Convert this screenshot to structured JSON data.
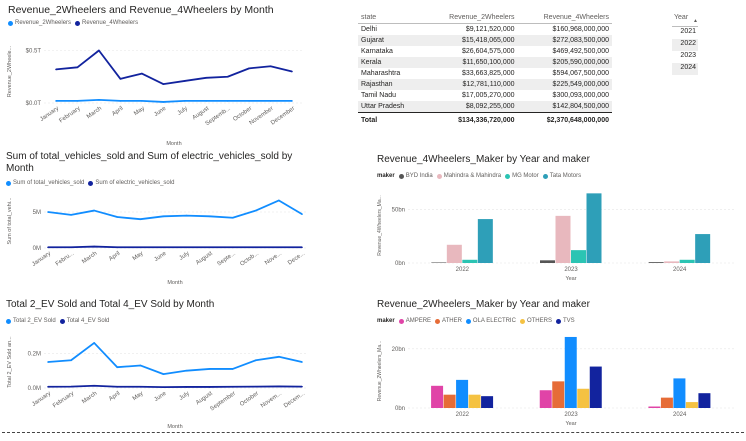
{
  "colors": {
    "light_blue": "#118DFF",
    "dark_blue": "#12239E",
    "byd": "#555555",
    "mahindra": "#E8B8BE",
    "mg": "#2BC4B3",
    "tata": "#2E9FB8",
    "ampere": "#E044A7",
    "ather": "#E66C37",
    "ola": "#118DFF",
    "others": "#F5C242",
    "tvs": "#12239E"
  },
  "months": [
    "January",
    "February",
    "March",
    "April",
    "May",
    "June",
    "July",
    "August",
    "September",
    "October",
    "November",
    "December"
  ],
  "chart1": {
    "title": "Revenue_2Wheelers and Revenue_4Wheelers by Month",
    "legend": [
      "Revenue_2Wheelers",
      "Revenue_4Wheelers"
    ],
    "xlabel": "Month",
    "ylabel": "Revenue_2Wheele...",
    "month_labels": [
      "January",
      "February",
      "March",
      "April",
      "May",
      "June",
      "July",
      "August",
      "Septemb...",
      "October",
      "November",
      "December"
    ],
    "y_ticks": [
      "$0.5T",
      "$0.0T"
    ]
  },
  "chart2": {
    "title_line1": "Sum of total_vehicles_sold and Sum of electric_vehicles_sold by",
    "title_line2": "Month",
    "legend": [
      "Sum of total_vehicles_sold",
      "Sum of electric_vehicles_sold"
    ],
    "xlabel": "Month",
    "ylabel": "Sum of total_vehi...",
    "month_labels": [
      "January",
      "Febru...",
      "March",
      "April",
      "May",
      "June",
      "July",
      "August",
      "Septe...",
      "Octob...",
      "Nove...",
      "Dece..."
    ],
    "y_ticks": [
      "5M",
      "0M"
    ]
  },
  "chart3": {
    "title": "Total 2_EV Sold and Total 4_EV Sold by Month",
    "legend": [
      "Total 2_EV Sold",
      "Total 4_EV Sold"
    ],
    "xlabel": "Month",
    "ylabel": "Total 2_EV Sold an...",
    "month_labels": [
      "January",
      "February",
      "March",
      "April",
      "May",
      "June",
      "July",
      "August",
      "September",
      "October",
      "Novem...",
      "Decem..."
    ],
    "y_ticks": [
      "0.2M",
      "0.0M"
    ]
  },
  "table": {
    "headers": [
      "state",
      "Revenue_2Wheelers",
      "Revenue_4Wheelers"
    ],
    "rows": [
      [
        "Delhi",
        "$9,121,520,000",
        "$160,968,000,000"
      ],
      [
        "Gujarat",
        "$15,418,065,000",
        "$272,083,500,000"
      ],
      [
        "Karnataka",
        "$26,604,575,000",
        "$469,492,500,000"
      ],
      [
        "Kerala",
        "$11,650,100,000",
        "$205,590,000,000"
      ],
      [
        "Maharashtra",
        "$33,663,825,000",
        "$594,067,500,000"
      ],
      [
        "Rajasthan",
        "$12,781,110,000",
        "$225,549,000,000"
      ],
      [
        "Tamil Nadu",
        "$17,005,270,000",
        "$300,093,000,000"
      ],
      [
        "Uttar Pradesh",
        "$8,092,255,000",
        "$142,804,500,000"
      ]
    ],
    "total": [
      "Total",
      "$134,336,720,000",
      "$2,370,648,000,000"
    ]
  },
  "slicer": {
    "header": "Year",
    "items": [
      "2021",
      "2022",
      "2023",
      "2024"
    ]
  },
  "chart4": {
    "title": "Revenue_4Wheelers_Maker by Year and maker",
    "legend_title": "maker",
    "legend": [
      "BYD India",
      "Mahindra & Mahindra",
      "MG Motor",
      "Tata Motors"
    ],
    "xlabel": "Year",
    "ylabel": "Revenue_4Wheelers_Ma...",
    "y_ticks": [
      "50bn",
      "0bn"
    ],
    "years": [
      "2022",
      "2023",
      "2024"
    ]
  },
  "chart5": {
    "title": "Revenue_2Wheelers_Maker by Year and maker",
    "legend_title": "maker",
    "legend": [
      "AMPERE",
      "ATHER",
      "OLA ELECTRIC",
      "OTHERS",
      "TVS"
    ],
    "xlabel": "Year",
    "ylabel": "Revenue_2Wheelers_Ma...",
    "y_ticks": [
      "20bn",
      "0bn"
    ],
    "years": [
      "2022",
      "2023",
      "2024"
    ]
  },
  "chart_data": [
    {
      "type": "line",
      "title": "Revenue_2Wheelers and Revenue_4Wheelers by Month",
      "xlabel": "Month",
      "ylabel": "Revenue_2Wheele...",
      "x": [
        "January",
        "February",
        "March",
        "April",
        "May",
        "June",
        "July",
        "August",
        "September",
        "October",
        "November",
        "December"
      ],
      "ylim": [
        0,
        0.6
      ],
      "y_unit": "trillion $",
      "series": [
        {
          "name": "Revenue_2Wheelers",
          "values": [
            0.02,
            0.02,
            0.03,
            0.02,
            0.02,
            0.01,
            0.02,
            0.02,
            0.02,
            0.02,
            0.02,
            0.02
          ]
        },
        {
          "name": "Revenue_4Wheelers",
          "values": [
            0.32,
            0.34,
            0.5,
            0.23,
            0.28,
            0.18,
            0.21,
            0.24,
            0.25,
            0.33,
            0.35,
            0.3
          ]
        }
      ]
    },
    {
      "type": "line",
      "title": "Sum of total_vehicles_sold and Sum of electric_vehicles_sold by Month",
      "xlabel": "Month",
      "ylabel": "Sum of total_vehi...",
      "x": [
        "January",
        "February",
        "March",
        "April",
        "May",
        "June",
        "July",
        "August",
        "September",
        "October",
        "November",
        "December"
      ],
      "ylim": [
        0,
        7.5
      ],
      "y_unit": "million",
      "series": [
        {
          "name": "Sum of total_vehicles_sold",
          "values": [
            5.0,
            4.6,
            5.2,
            4.3,
            4.0,
            4.4,
            4.5,
            4.4,
            4.2,
            5.2,
            6.6,
            4.7
          ]
        },
        {
          "name": "Sum of electric_vehicles_sold",
          "values": [
            0.1,
            0.1,
            0.2,
            0.1,
            0.1,
            0.1,
            0.1,
            0.1,
            0.1,
            0.1,
            0.1,
            0.1
          ]
        }
      ]
    },
    {
      "type": "line",
      "title": "Total 2_EV Sold and Total 4_EV Sold by Month",
      "xlabel": "Month",
      "ylabel": "Total 2_EV Sold an...",
      "x": [
        "January",
        "February",
        "March",
        "April",
        "May",
        "June",
        "July",
        "August",
        "September",
        "October",
        "November",
        "December"
      ],
      "ylim": [
        0,
        0.3
      ],
      "y_unit": "million",
      "series": [
        {
          "name": "Total 2_EV Sold",
          "values": [
            0.15,
            0.16,
            0.26,
            0.12,
            0.13,
            0.08,
            0.1,
            0.11,
            0.11,
            0.16,
            0.18,
            0.15
          ]
        },
        {
          "name": "Total 4_EV Sold",
          "values": [
            0.007,
            0.008,
            0.013,
            0.007,
            0.007,
            0.005,
            0.006,
            0.006,
            0.007,
            0.008,
            0.009,
            0.008
          ]
        }
      ]
    },
    {
      "type": "bar",
      "title": "Revenue_4Wheelers_Maker by Year and maker",
      "xlabel": "Year",
      "ylabel": "Revenue_4Wheelers_Ma...",
      "categories": [
        "2022",
        "2023",
        "2024"
      ],
      "ylim": [
        0,
        70
      ],
      "y_unit": "bn",
      "series": [
        {
          "name": "BYD India",
          "values": [
            0.5,
            2.5,
            0.8
          ]
        },
        {
          "name": "Mahindra & Mahindra",
          "values": [
            17,
            44,
            1.5
          ]
        },
        {
          "name": "MG Motor",
          "values": [
            3,
            12,
            3
          ]
        },
        {
          "name": "Tata Motors",
          "values": [
            41,
            65,
            27
          ]
        }
      ]
    },
    {
      "type": "bar",
      "title": "Revenue_2Wheelers_Maker by Year and maker",
      "xlabel": "Year",
      "ylabel": "Revenue_2Wheelers_Ma...",
      "categories": [
        "2022",
        "2023",
        "2024"
      ],
      "ylim": [
        0,
        25
      ],
      "y_unit": "bn",
      "series": [
        {
          "name": "AMPERE",
          "values": [
            7.5,
            6,
            0.5
          ]
        },
        {
          "name": "ATHER",
          "values": [
            4.5,
            9,
            3.5
          ]
        },
        {
          "name": "OLA ELECTRIC",
          "values": [
            9.5,
            24,
            10
          ]
        },
        {
          "name": "OTHERS",
          "values": [
            4.5,
            6.5,
            2
          ]
        },
        {
          "name": "TVS",
          "values": [
            4,
            14,
            5
          ]
        }
      ]
    }
  ]
}
